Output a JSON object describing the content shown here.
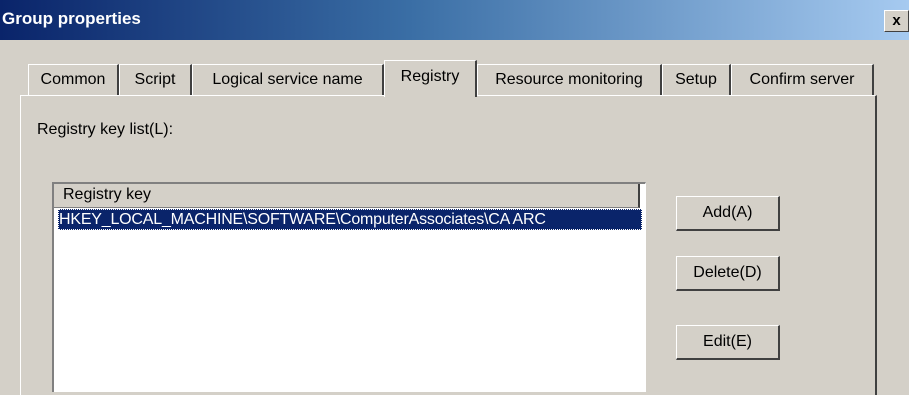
{
  "window": {
    "title": "Group properties",
    "close_glyph": "x"
  },
  "tabs": [
    {
      "label": "Common",
      "active": false
    },
    {
      "label": "Script",
      "active": false
    },
    {
      "label": "Logical service name",
      "active": false
    },
    {
      "label": "Registry",
      "active": true
    },
    {
      "label": "Resource monitoring",
      "active": false
    },
    {
      "label": "Setup",
      "active": false
    },
    {
      "label": "Confirm server",
      "active": false
    }
  ],
  "registry": {
    "list_label": "Registry key list(L):",
    "column_header": "Registry key",
    "rows": [
      {
        "key": "HKEY_LOCAL_MACHINE\\SOFTWARE\\ComputerAssociates\\CA ARC",
        "selected": true
      }
    ]
  },
  "buttons": {
    "add": "Add(A)",
    "delete": "Delete(D)",
    "edit": "Edit(E)"
  },
  "colors": {
    "face": "#d4d0c8",
    "title_start": "#0a246a",
    "title_end": "#a6caf0",
    "selection": "#0a246a"
  }
}
